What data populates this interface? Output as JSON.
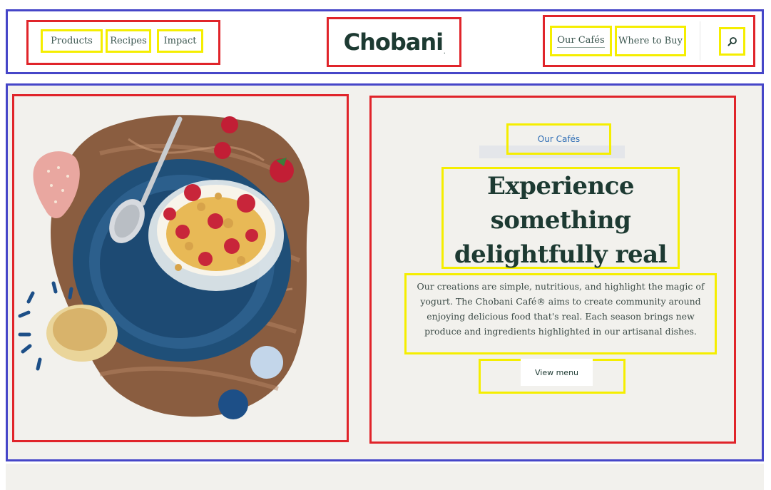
{
  "header": {
    "nav_left": [
      "Products",
      "Recipes",
      "Impact"
    ],
    "logo_text": "Chobani",
    "logo_mark": ".",
    "nav_right": [
      "Our Cafés",
      "Where to Buy"
    ],
    "search_icon": "search-icon"
  },
  "hero": {
    "image_alt": "Yogurt parfait with strawberries and granola on a blue plate",
    "eyebrow": "Our Cafés",
    "headline": [
      "Experience",
      "something",
      "delightfully real"
    ],
    "body": "Our creations are simple, nutritious, and highlight the magic of yogurt. The Chobani Café® aims to create community around enjoying delicious food that's real. Each season brings new produce and ingredients highlighted in our artisanal dishes.",
    "cta": "View menu"
  },
  "colors": {
    "brand": "#1d3a32",
    "accent": "#2e6db5",
    "annotation_blue": "#4646c8",
    "annotation_red": "#e0242a",
    "annotation_yellow": "#f5ee00"
  }
}
